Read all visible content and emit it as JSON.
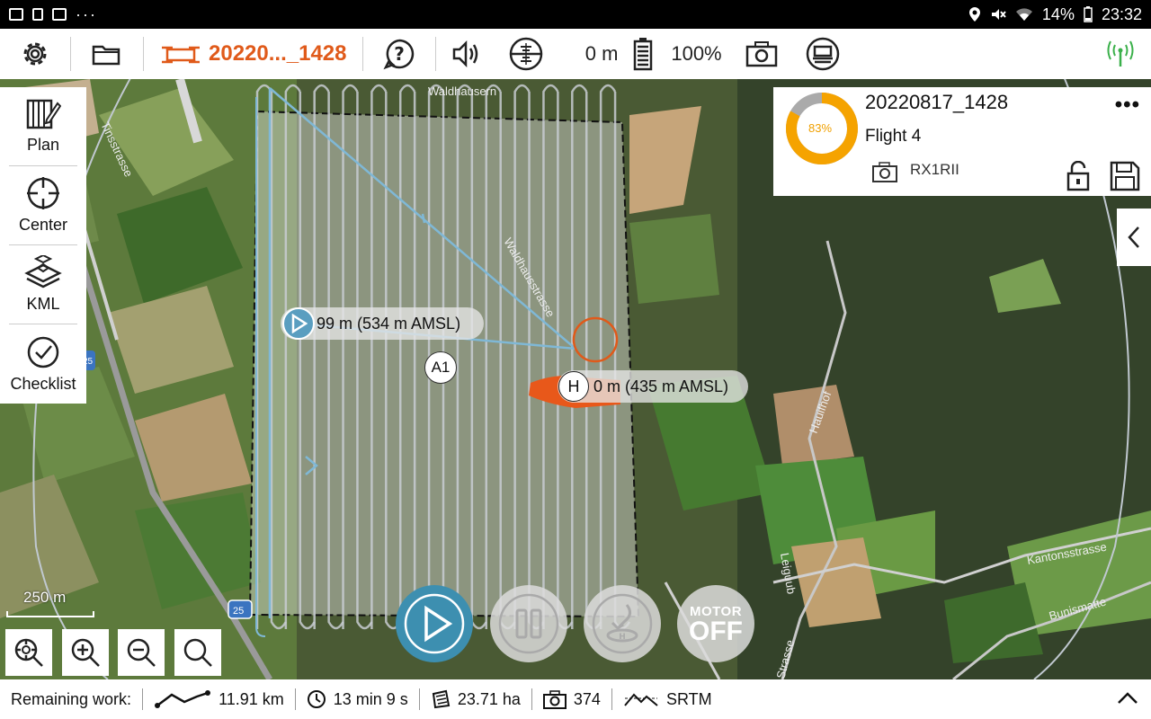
{
  "statusbar": {
    "more": "···",
    "battery_text": "14%",
    "time": "23:32"
  },
  "toolbar": {
    "mission_name": "20220..._1428",
    "altitude": "0 m",
    "battery": "100%"
  },
  "left_panel": {
    "items": [
      {
        "label": "Plan"
      },
      {
        "label": "Center"
      },
      {
        "label": "KML"
      },
      {
        "label": "Checklist"
      }
    ]
  },
  "info_panel": {
    "title": "20220817_1428",
    "flight": "Flight 4",
    "camera": "RX1RII",
    "progress_text": "83%",
    "progress_value": 83,
    "more": "•••"
  },
  "map": {
    "start_label": "99 m (534 m AMSL)",
    "home_label": "0 m (435 m AMSL)",
    "home_marker": "H",
    "area_marker": "A1",
    "scale": "250 m",
    "place_labels": [
      "Waldhausern",
      "Waldhausstrasse",
      "Hauifhof",
      "Kantonsstrasse",
      "Bunismatte",
      "Leiguub",
      "Tinsstrasse",
      "Strasse"
    ],
    "road_badges": [
      "25",
      "25"
    ]
  },
  "flight_controls": {
    "motor_top": "MOTOR",
    "motor_bottom": "OFF"
  },
  "bottombar": {
    "remaining_label": "Remaining work:",
    "distance": "11.91 km",
    "time": "13 min 9 s",
    "area": "23.71 ha",
    "photos": "374",
    "elevation_source": "SRTM"
  },
  "colors": {
    "accent_orange": "#e05a1a",
    "progress": "#f5a300",
    "path_blue": "#7fb8d6",
    "play_blue": "#3d8fb0"
  }
}
